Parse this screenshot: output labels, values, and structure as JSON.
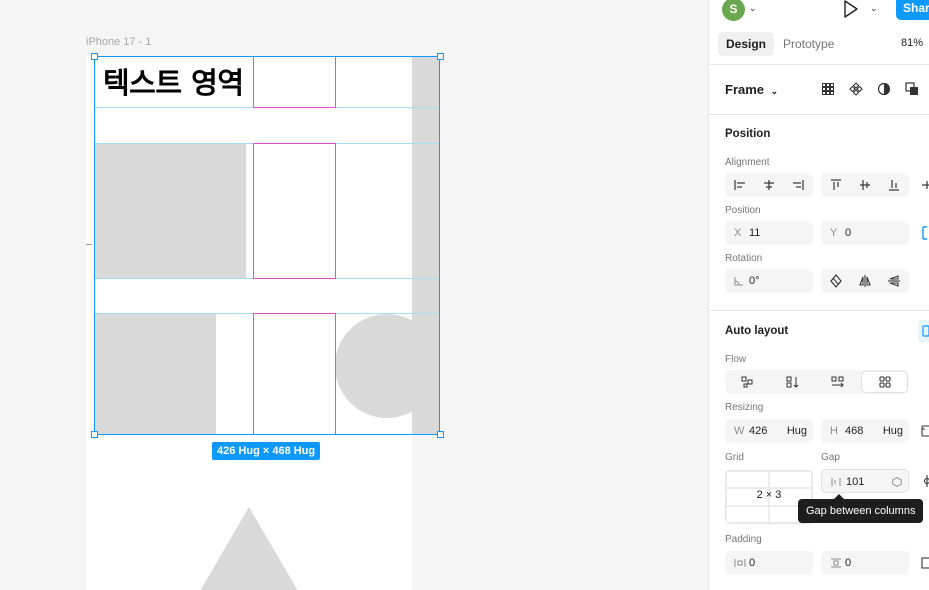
{
  "canvas": {
    "frame_label": "iPhone 17 - 1",
    "text_area": "텍스트 영역",
    "size_badge": "426 Hug × 468 Hug"
  },
  "header": {
    "avatar_letter": "S",
    "share_label": "Share",
    "tabs": [
      {
        "label": "Design",
        "active": true
      },
      {
        "label": "Prototype",
        "active": false
      }
    ],
    "zoom": "81%"
  },
  "frame_section": {
    "title": "Frame"
  },
  "position": {
    "title": "Position",
    "alignment_label": "Alignment",
    "position_label": "Position",
    "x_prefix": "X",
    "x_value": "11",
    "y_prefix": "Y",
    "y_value": "0",
    "rotation_label": "Rotation",
    "rotation_value": "0°"
  },
  "auto_layout": {
    "title": "Auto layout",
    "flow_label": "Flow",
    "resizing_label": "Resizing",
    "w_prefix": "W",
    "w_value": "426",
    "w_mode": "Hug",
    "h_prefix": "H",
    "h_value": "468",
    "h_mode": "Hug",
    "grid_label": "Grid",
    "grid_value": "2 × 3",
    "gap_label": "Gap",
    "gap_value": "101",
    "tooltip": "Gap between columns",
    "padding_label": "Padding",
    "padding_h_value": "0",
    "padding_v_value": "0"
  },
  "colors": {
    "accent": "#0d99ff",
    "selection_cell": "#e04ad2",
    "placeholder_gray": "#d9d9d9"
  }
}
